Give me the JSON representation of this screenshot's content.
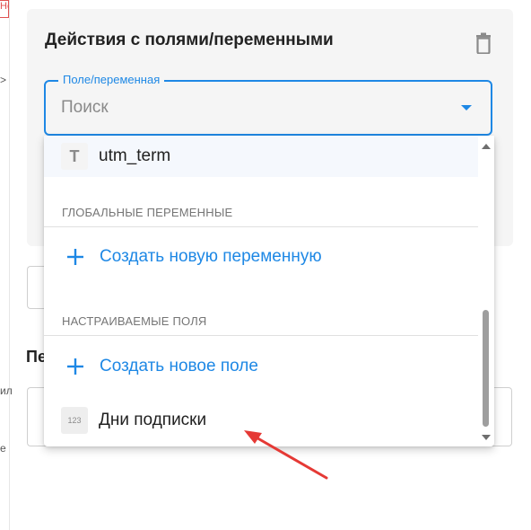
{
  "card": {
    "title": "Действия с полями/переменными"
  },
  "select": {
    "legend": "Поле/переменная",
    "placeholder": "Поиск"
  },
  "background": {
    "heading_fragment": "Пе",
    "side_fragments": [
      "Не",
      ">",
      "ил",
      "е"
    ]
  },
  "dropdown": {
    "items": [
      {
        "icon": "text-type-icon",
        "icon_glyph": "T",
        "label": "utm_term"
      }
    ],
    "section_global": "ГЛОБАЛЬНЫЕ ПЕРЕМЕННЫЕ",
    "create_variable": "Создать новую переменную",
    "section_custom": "НАСТРАИВАЕМЫЕ ПОЛЯ",
    "create_field": "Создать новое поле",
    "custom_items": [
      {
        "icon": "number-type-icon",
        "icon_glyph": "123",
        "label": "Дни подписки"
      }
    ]
  },
  "colors": {
    "accent": "#1e88e5",
    "arrow": "#e53935",
    "card_bg": "#f5f5f5"
  }
}
